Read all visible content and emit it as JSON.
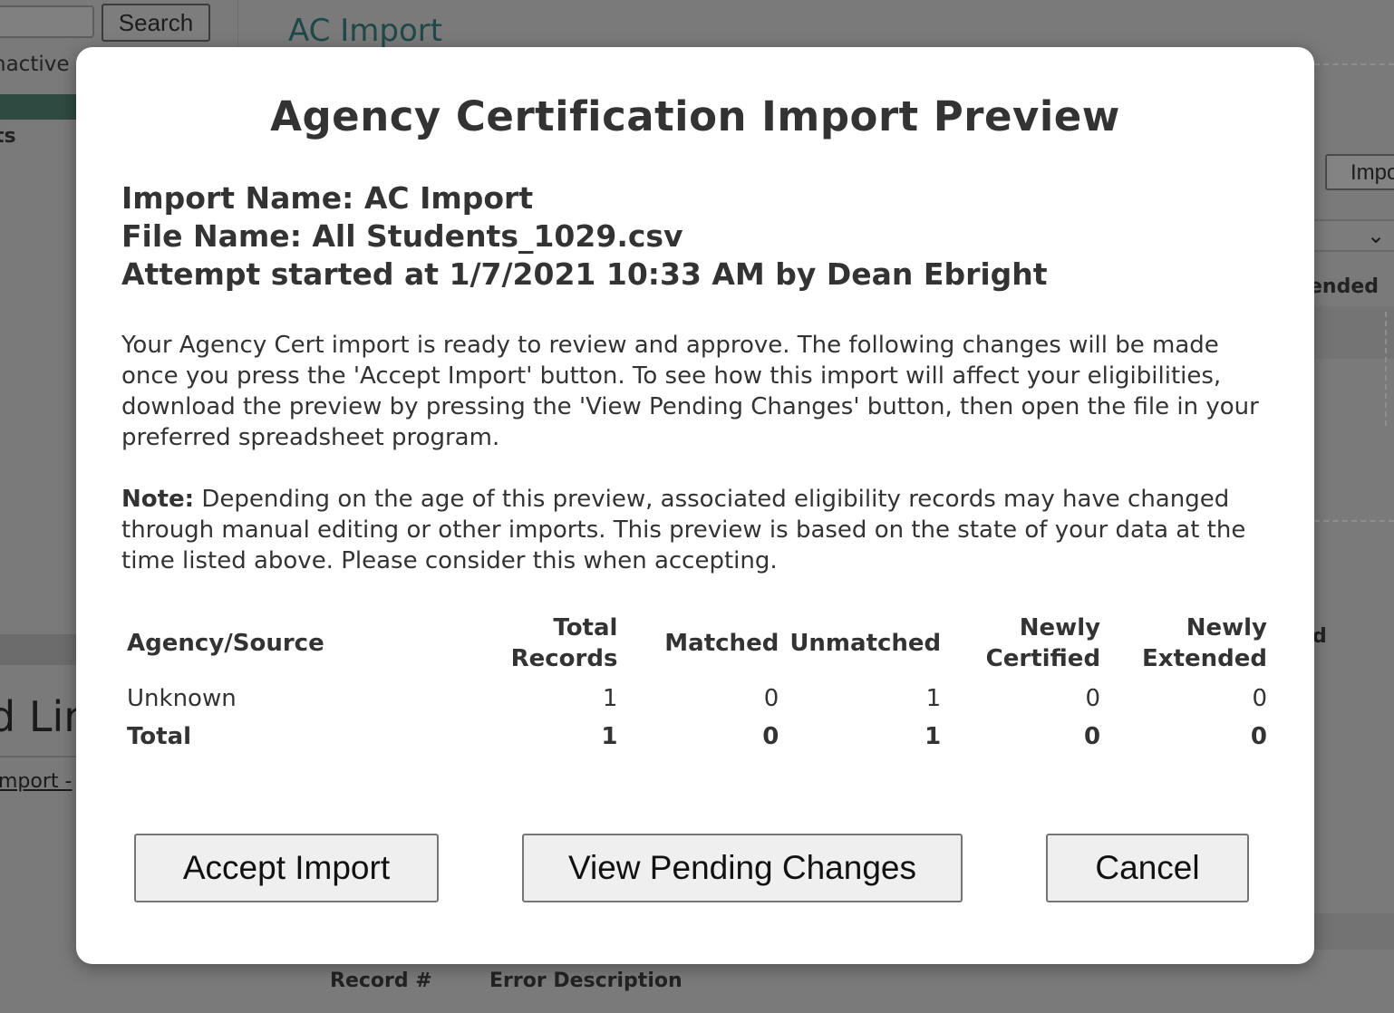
{
  "background": {
    "search_button": "Search",
    "heading": "AC Import",
    "inactive_label": "nactive",
    "ts_label": "ts",
    "import_button": "Impo",
    "ended_label": "ended",
    "d_label": "d",
    "big_text": "d Lin",
    "import_link": "mport -",
    "table_headers": {
      "record": "Record #",
      "error": "Error Description"
    }
  },
  "modal": {
    "title": "Agency Certification Import Preview",
    "import_name": "Import Name: AC Import",
    "file_name": "File Name: All Students_1029.csv",
    "attempt": "Attempt started at 1/7/2021 10:33 AM by Dean Ebright",
    "description": "Your Agency Cert import is ready to review and approve. The following changes will be made once you press the 'Accept Import' button. To see how this import will affect your eligibilities, download the preview by pressing the 'View Pending Changes' button, then open the file in your preferred spreadsheet program.",
    "note_label": "Note:",
    "note_text": " Depending on the age of this preview, associated eligibility records may have changed through manual editing or other imports. This preview is based on the state of your data at the time listed above. Please consider this when accepting.",
    "table": {
      "headers": {
        "agency": "Agency/Source",
        "total_1": "Total",
        "total_2": "Records",
        "matched": "Matched",
        "unmatched": "Unmatched",
        "cert_1": "Newly",
        "cert_2": "Certified",
        "ext_1": "Newly",
        "ext_2": "Extended"
      },
      "rows": [
        {
          "agency": "Unknown",
          "total": "1",
          "matched": "0",
          "unmatched": "1",
          "certified": "0",
          "extended": "0"
        }
      ],
      "total_row": {
        "agency": "Total",
        "total": "1",
        "matched": "0",
        "unmatched": "1",
        "certified": "0",
        "extended": "0"
      }
    },
    "buttons": {
      "accept": "Accept Import",
      "view": "View Pending Changes",
      "cancel": "Cancel"
    }
  }
}
